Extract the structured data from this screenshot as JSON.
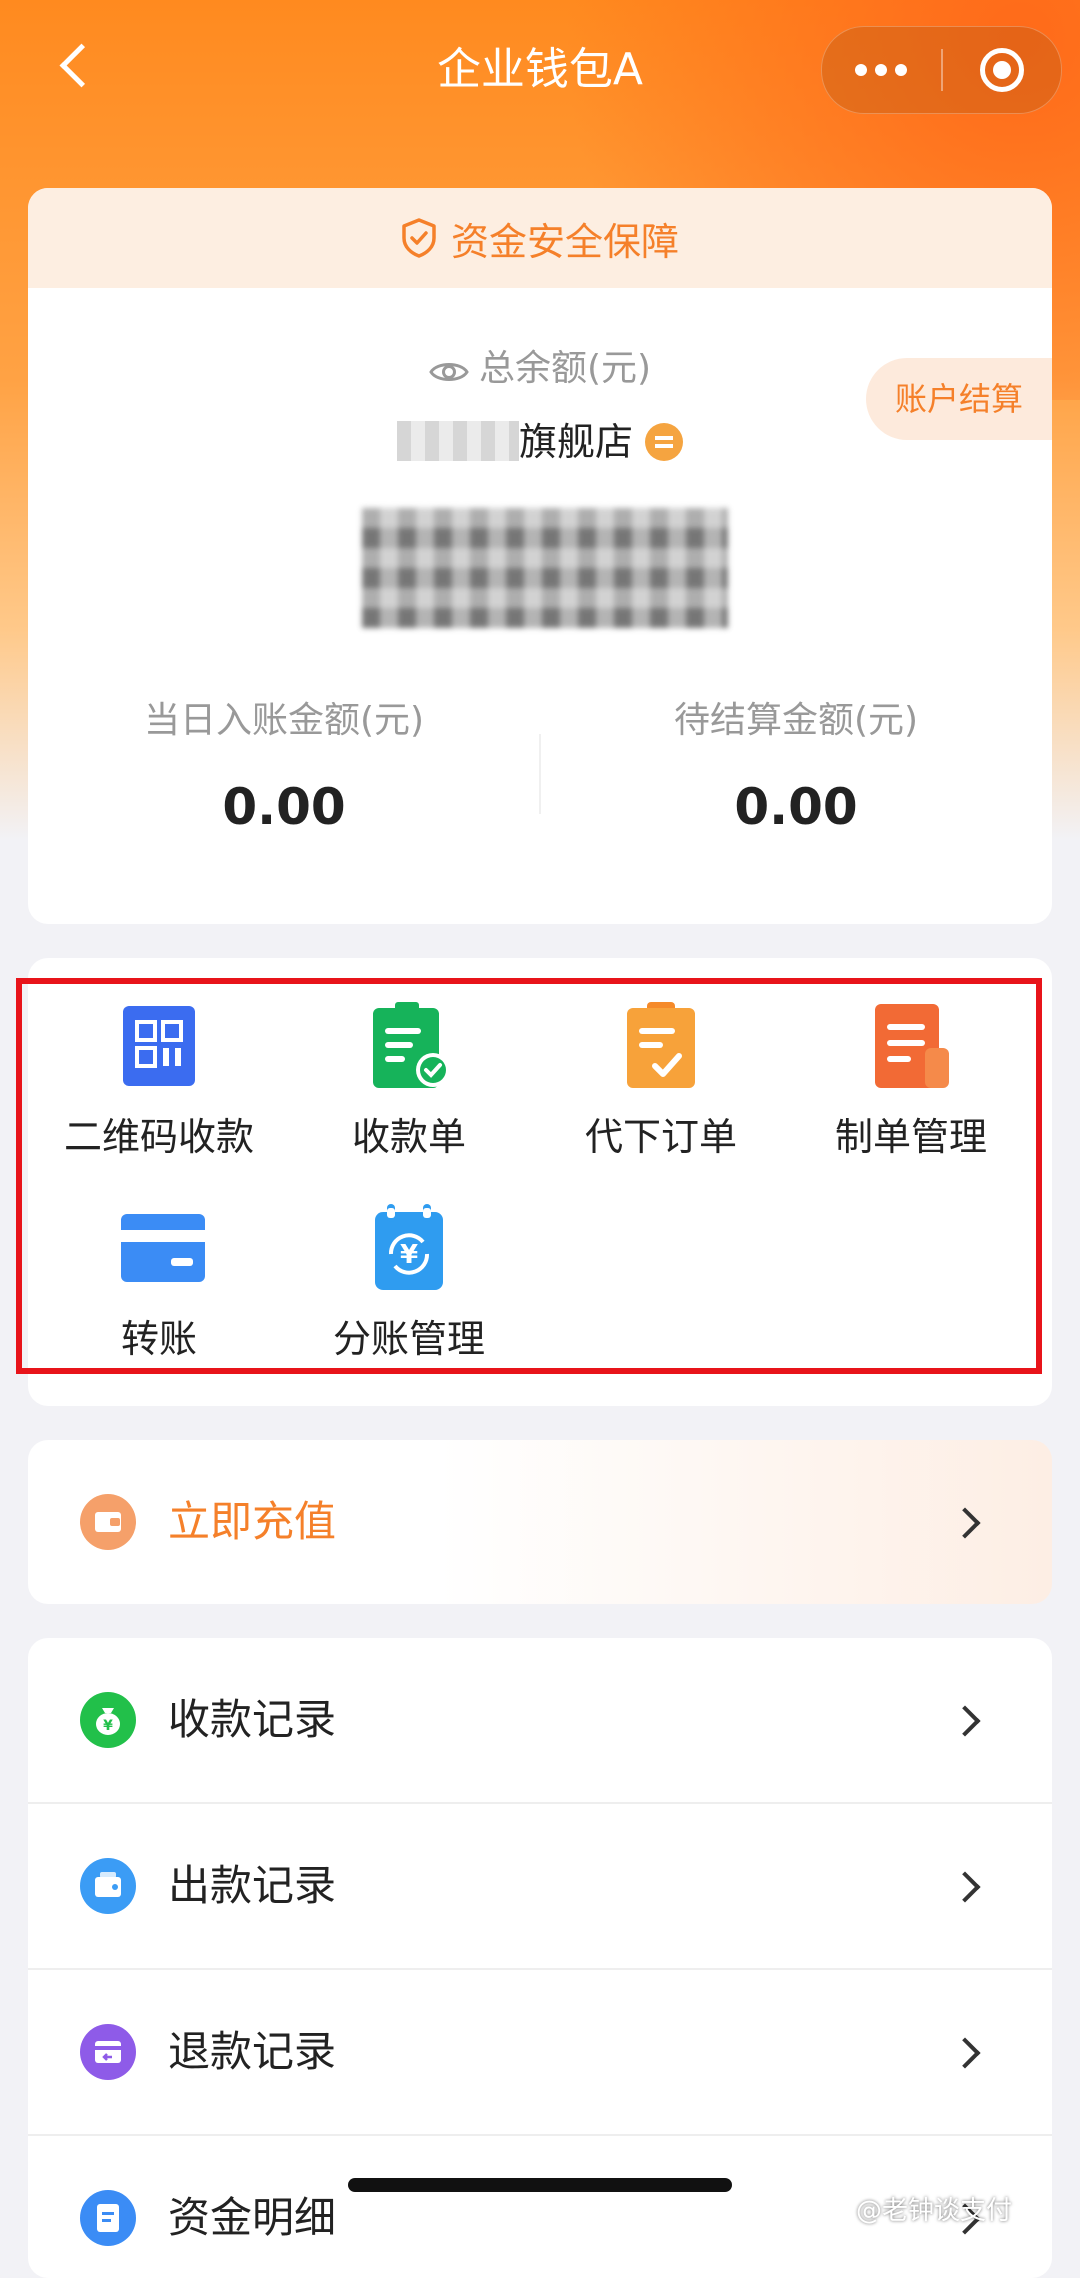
{
  "nav": {
    "title": "企业钱包A",
    "more_icon": "more-dots-icon",
    "close_icon": "target-close-icon"
  },
  "balance": {
    "safety_text": "资金安全保障",
    "total_label": "总余额(元)",
    "shop_name_suffix": "旗舰店",
    "settle_button": "账户结算",
    "today_label": "当日入账金额(元)",
    "today_value": "0.00",
    "pending_label": "待结算金额(元)",
    "pending_value": "0.00"
  },
  "grid": {
    "items": [
      {
        "label": "二维码收款",
        "icon": "qrcode-icon",
        "color": "#3b6cf0"
      },
      {
        "label": "收款单",
        "icon": "receipt-icon",
        "color": "#16b35a"
      },
      {
        "label": "代下订单",
        "icon": "clipboard-check-icon",
        "color": "#f7a23a"
      },
      {
        "label": "制单管理",
        "icon": "document-icon",
        "color": "#f26a35"
      },
      {
        "label": "转账",
        "icon": "card-icon",
        "color": "#3b8cf5"
      },
      {
        "label": "分账管理",
        "icon": "split-calendar-icon",
        "color": "#2f9cf0"
      }
    ]
  },
  "recharge": {
    "label": "立即充值",
    "color": "#f5802a"
  },
  "records": [
    {
      "label": "收款记录",
      "icon": "money-bag-icon",
      "color": "#22c04a"
    },
    {
      "label": "出款记录",
      "icon": "wallet-icon",
      "color": "#3b9cf5"
    },
    {
      "label": "退款记录",
      "icon": "refund-icon",
      "color": "#8e5be8"
    },
    {
      "label": "资金明细",
      "icon": "detail-icon",
      "color": "#3b8cf5"
    }
  ],
  "watermark": "@老钟谈支付"
}
